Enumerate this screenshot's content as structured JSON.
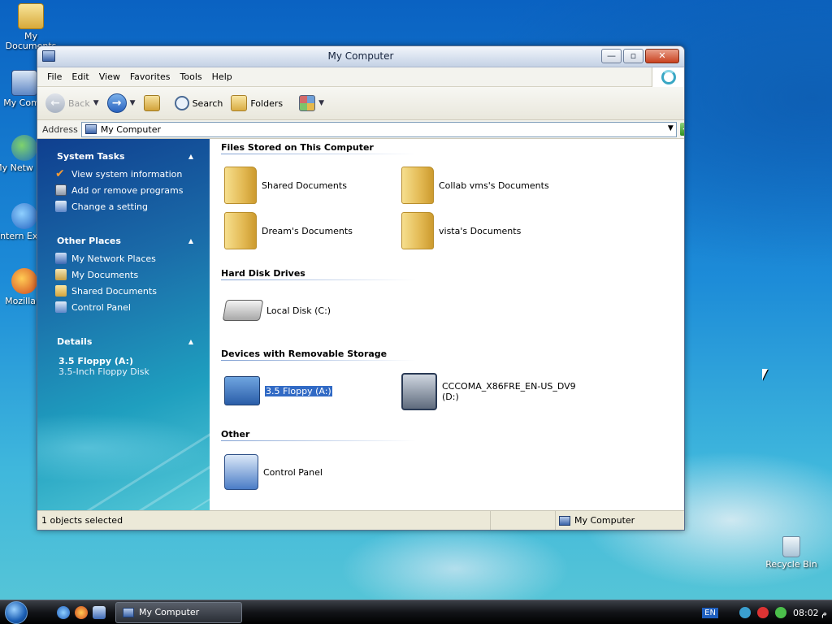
{
  "desktop": {
    "icons": [
      {
        "label": "My Documents"
      },
      {
        "label": "My Comp"
      },
      {
        "label": "My Netw Plac"
      },
      {
        "label": "Intern Explo"
      },
      {
        "label": "Mozilla F"
      },
      {
        "label": "Recycle Bin"
      }
    ]
  },
  "window": {
    "title": "My Computer",
    "controls": {
      "minimize": "—",
      "maximize": "▫",
      "close": "✕"
    },
    "menu": [
      "File",
      "Edit",
      "View",
      "Favorites",
      "Tools",
      "Help"
    ],
    "toolbar": {
      "back": "Back",
      "search": "Search",
      "folders": "Folders"
    },
    "address": {
      "label": "Address",
      "value": "My Computer",
      "go": "Go"
    }
  },
  "taskpane": {
    "system_tasks": {
      "title": "System Tasks",
      "items": [
        "View system information",
        "Add or remove programs",
        "Change a setting"
      ]
    },
    "other_places": {
      "title": "Other Places",
      "items": [
        "My Network Places",
        "My Documents",
        "Shared Documents",
        "Control Panel"
      ]
    },
    "details": {
      "title": "Details",
      "name": "3.5 Floppy (A:)",
      "type": "3.5-Inch Floppy Disk"
    }
  },
  "content": {
    "groups": [
      {
        "title": "Files Stored on This Computer",
        "items": [
          "Shared Documents",
          "Collab vms's Documents",
          "Dream's Documents",
          "vista's Documents"
        ]
      },
      {
        "title": "Hard Disk Drives",
        "items": [
          "Local Disk (C:)"
        ]
      },
      {
        "title": "Devices with Removable Storage",
        "items": [
          "3.5 Floppy (A:)",
          "CCCOMA_X86FRE_EN-US_DV9",
          "(D:)"
        ]
      },
      {
        "title": "Other",
        "items": [
          "Control Panel"
        ]
      }
    ]
  },
  "status": {
    "selection": "1 objects selected",
    "location": "My Computer"
  },
  "taskbar": {
    "button": "My Computer",
    "lang": "EN",
    "clock": "م 08:02"
  },
  "colors": {
    "selection": "#316ac5",
    "taskpane": "#1a6aa8",
    "taskbar": "#121418"
  }
}
